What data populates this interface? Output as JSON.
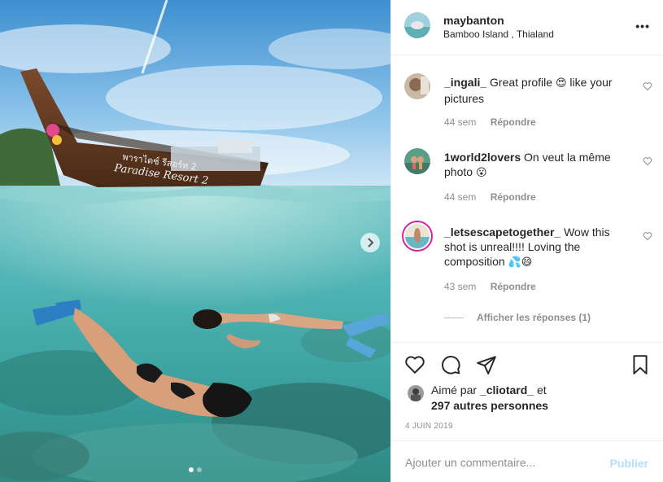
{
  "post": {
    "username": "maybanton",
    "location": "Bamboo Island , Thialand",
    "more_label": "•••"
  },
  "photo": {
    "boat_text_line1": "พาราไดซ์ รีสอร์ท 2",
    "boat_text_line2": "Paradise Resort 2",
    "slides_total": 2,
    "slides_active": 1
  },
  "comments": [
    {
      "username": "_ingali_",
      "text": "Great profile",
      "emoji": "😍",
      "text_after": "like your pictures",
      "time": "44 sem",
      "reply_label": "Répondre"
    },
    {
      "username": "1world2lovers",
      "text": "On veut la même photo",
      "emoji": "😮",
      "text_after": "",
      "time": "44 sem",
      "reply_label": "Répondre"
    },
    {
      "username": "_letsescapetogether_",
      "text": "Wow this shot is unreal!!!! Loving the composition",
      "emoji": "💦😄",
      "text_after": "",
      "time": "43 sem",
      "reply_label": "Répondre"
    }
  ],
  "view_replies_label": "Afficher les réponses (1)",
  "likes": {
    "prefix": "Aimé par",
    "liker": "_cliotard_",
    "connector": "et",
    "others": "297 autres personnes"
  },
  "date": "4 JUIN 2019",
  "add_comment": {
    "placeholder": "Ajouter un commentaire...",
    "publish_label": "Publier"
  },
  "colors": {
    "publish_disabled": "#b2dffc",
    "secondary_text": "#8e8e8e",
    "story_ring": "#d6249f"
  },
  "icons": [
    "heart-icon",
    "comment-icon",
    "share-icon",
    "bookmark-icon",
    "chevron-right-icon",
    "more-icon"
  ]
}
